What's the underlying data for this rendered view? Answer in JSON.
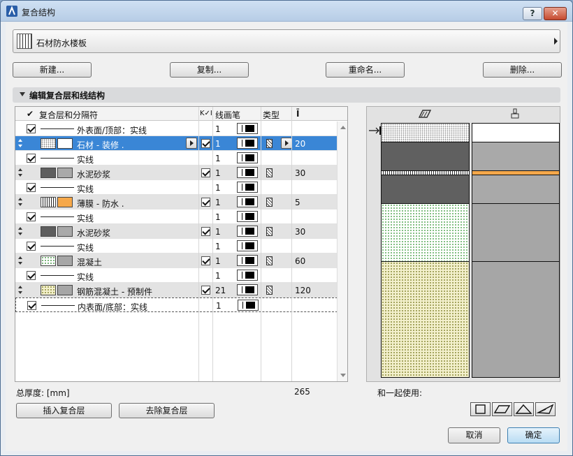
{
  "window": {
    "title": "复合结构",
    "help_label": "?",
    "close_label": "✕"
  },
  "selector": {
    "current": "石材防水楼板"
  },
  "actions": {
    "new": "新建...",
    "duplicate": "复制...",
    "rename": "重命名...",
    "delete": "删除..."
  },
  "section": {
    "title": "编辑复合层和线结构"
  },
  "table": {
    "headers": {
      "layers": "复合层和分隔符",
      "pen": "线画笔",
      "type": "类型"
    },
    "rows": [
      {
        "kind": "line",
        "label": "外表面/顶部：实线",
        "pen": "1",
        "checked": true
      },
      {
        "kind": "layer",
        "label": "石材 - 装修 .",
        "pen": "1",
        "thickness": "20",
        "checked": true,
        "selected": true,
        "pat": "dots-white",
        "color": "#ffffff"
      },
      {
        "kind": "line",
        "label": "实线",
        "pen": "1",
        "checked": true
      },
      {
        "kind": "layer",
        "label": "水泥砂浆",
        "pen": "1",
        "thickness": "30",
        "checked": true,
        "pat": "dense",
        "color": "#a9a9a9"
      },
      {
        "kind": "line",
        "label": "实线",
        "pen": "1",
        "checked": true
      },
      {
        "kind": "layer",
        "label": "薄膜 - 防水 .",
        "pen": "1",
        "thickness": "5",
        "checked": true,
        "pat": "vlines",
        "color": "#f6a84a"
      },
      {
        "kind": "line",
        "label": "实线",
        "pen": "1",
        "checked": true
      },
      {
        "kind": "layer",
        "label": "水泥砂浆",
        "pen": "1",
        "thickness": "30",
        "checked": true,
        "pat": "dense",
        "color": "#a9a9a9"
      },
      {
        "kind": "line",
        "label": "实线",
        "pen": "1",
        "checked": true
      },
      {
        "kind": "layer",
        "label": "混凝土",
        "pen": "1",
        "thickness": "60",
        "checked": true,
        "pat": "green-dots",
        "color": "#a6a6a6"
      },
      {
        "kind": "line",
        "label": "实线",
        "pen": "1",
        "checked": true
      },
      {
        "kind": "layer",
        "label": "钢筋混凝土 - 预制件",
        "pen": "21",
        "thickness": "120",
        "checked": true,
        "pat": "yellow-dots",
        "color": "#a6a6a6"
      },
      {
        "kind": "line",
        "label": "内表面/底部：实线",
        "pen": "1",
        "checked": true,
        "last": true
      }
    ]
  },
  "footer": {
    "total_label": "总厚度: [mm]",
    "total_value": "265",
    "use_with_label": "和一起使用:",
    "insert_button": "插入复合层",
    "remove_button": "去除复合层",
    "cancel_button": "取消",
    "ok_button": "确定"
  },
  "colors": {
    "selection": "#3a86d6",
    "membrane": "#f6a84a",
    "section": "#d9dadc"
  }
}
